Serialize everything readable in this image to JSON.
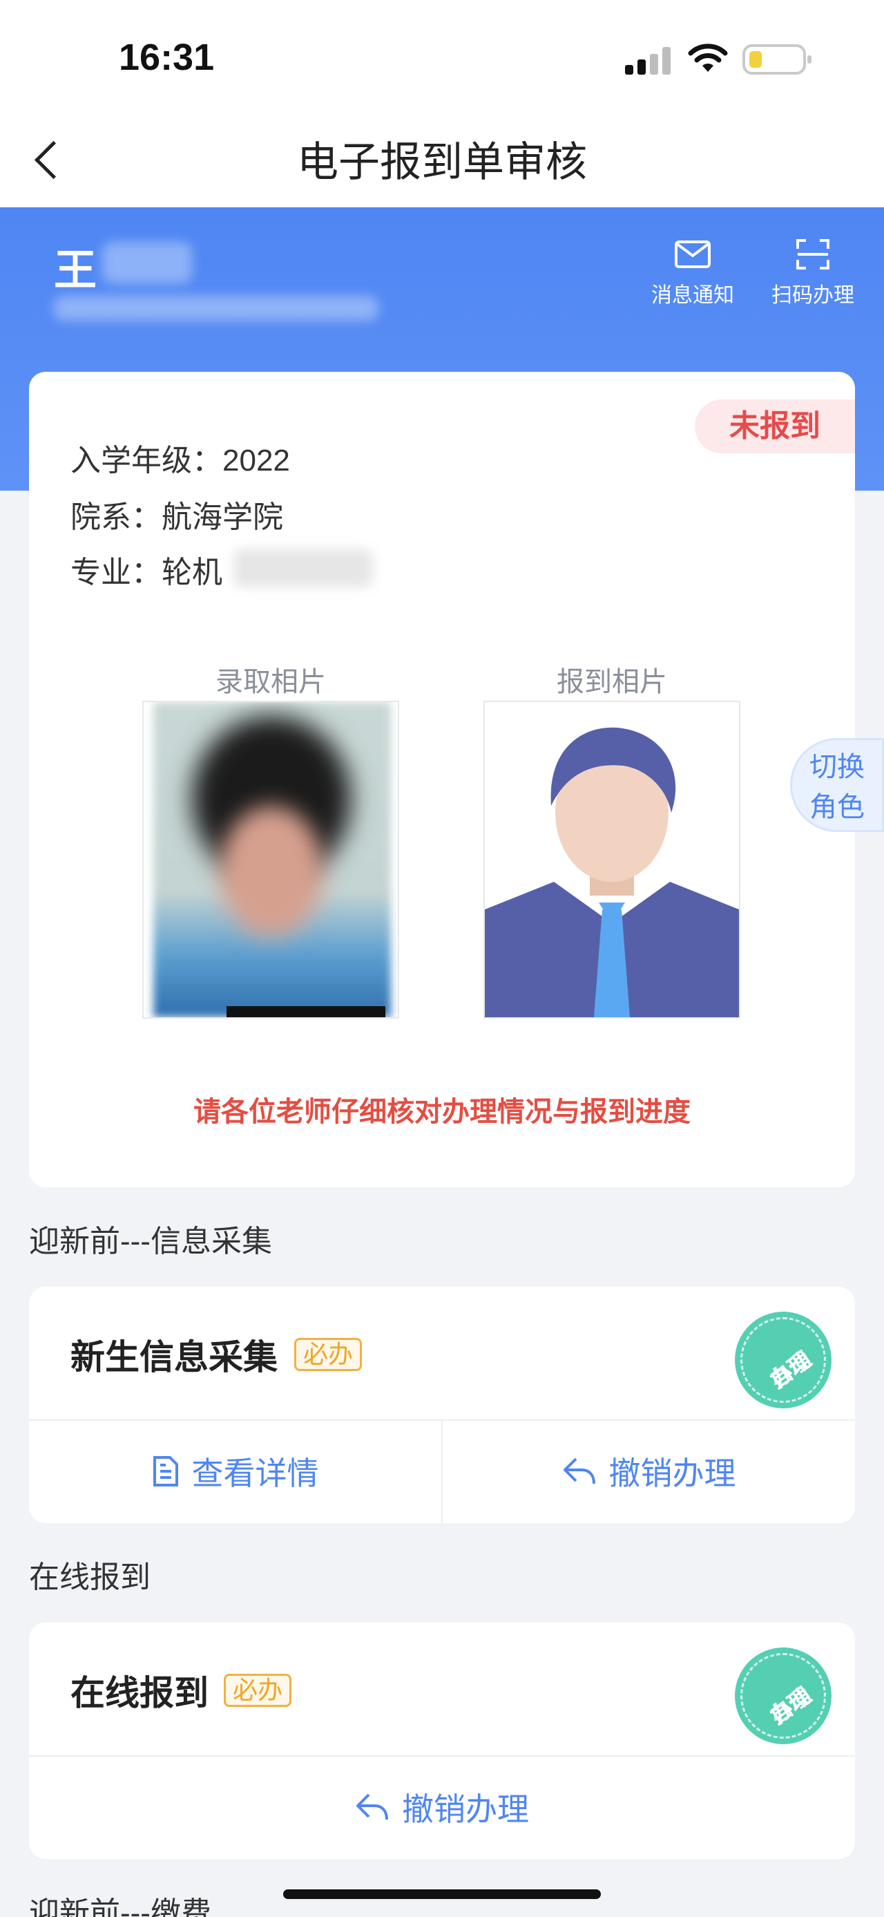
{
  "status_bar": {
    "time": "16:31"
  },
  "nav": {
    "title": "电子报到单审核"
  },
  "header": {
    "user_name": "王",
    "actions": [
      {
        "label": "消息通知",
        "icon": "mail-icon"
      },
      {
        "label": "扫码办理",
        "icon": "scan-icon"
      }
    ]
  },
  "info_card": {
    "status": "未报到",
    "grade": "入学年级：2022",
    "department": "院系：航海学院",
    "major": "专业：轮机",
    "admission_photo_label": "录取相片",
    "checkin_photo_label": "报到相片",
    "notice": "请各位老师仔细核对办理情况与报到进度"
  },
  "switch_role": {
    "line1": "切换",
    "line2": "角色"
  },
  "sections": [
    {
      "title": "迎新前---信息采集",
      "task": {
        "name": "新生信息采集",
        "tag": "必办",
        "stamp": "自动办理",
        "stamp_line1": "自动",
        "stamp_line2": "办理",
        "actions": [
          "查看详情",
          "撤销办理"
        ]
      }
    },
    {
      "title": "在线报到",
      "task": {
        "name": "在线报到",
        "tag": "必办",
        "stamp": "自动办理",
        "stamp_line1": "自动",
        "stamp_line2": "办理",
        "actions": [
          "撤销办理"
        ]
      }
    },
    {
      "title": "迎新前---缴费"
    }
  ],
  "colors": {
    "primary": "#4f86f3",
    "danger": "#e54d42",
    "tag": "#f3a322",
    "stamp": "#54cfb2"
  }
}
